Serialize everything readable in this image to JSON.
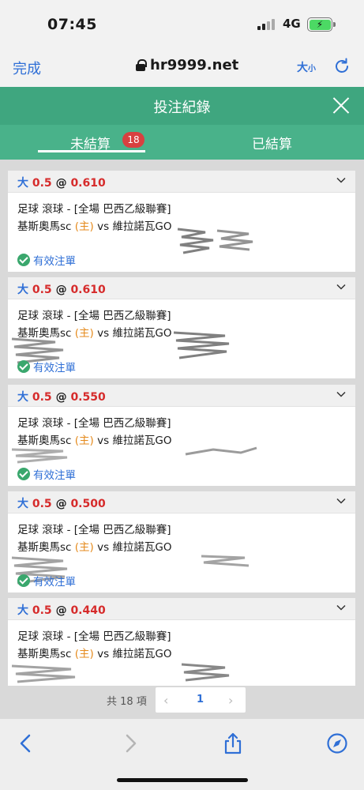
{
  "status_bar": {
    "time": "07:45",
    "network": "4G"
  },
  "browser": {
    "done_label": "完成",
    "url": "hr9999.net",
    "text_size_big": "大",
    "text_size_small": "小"
  },
  "header": {
    "title": "投注紀錄"
  },
  "tabs": {
    "unsettled": "未結算",
    "unsettled_count": "18",
    "settled": "已結算"
  },
  "bets": [
    {
      "over_label": "大",
      "line": "0.5",
      "at": "@",
      "odds": "0.610",
      "sport": "足球 滾球 - [全場 巴西乙級聯賽]",
      "team_home": "基斯奧馬sc",
      "home_tag": "(主)",
      "vs": "vs",
      "team_away": "維拉諾瓦GO",
      "status": "有效注單"
    },
    {
      "over_label": "大",
      "line": "0.5",
      "at": "@",
      "odds": "0.610",
      "sport": "足球 滾球 - [全場 巴西乙級聯賽]",
      "team_home": "基斯奧馬sc",
      "home_tag": "(主)",
      "vs": "vs",
      "team_away": "維拉諾瓦GO",
      "status": "有效注單"
    },
    {
      "over_label": "大",
      "line": "0.5",
      "at": "@",
      "odds": "0.550",
      "sport": "足球 滾球 - [全場 巴西乙級聯賽]",
      "team_home": "基斯奧馬sc",
      "home_tag": "(主)",
      "vs": "vs",
      "team_away": "維拉諾瓦GO",
      "status": "有效注單"
    },
    {
      "over_label": "大",
      "line": "0.5",
      "at": "@",
      "odds": "0.500",
      "sport": "足球 滾球 - [全場 巴西乙級聯賽]",
      "team_home": "基斯奧馬sc",
      "home_tag": "(主)",
      "vs": "vs",
      "team_away": "維拉諾瓦GO",
      "status": "有效注單"
    },
    {
      "over_label": "大",
      "line": "0.5",
      "at": "@",
      "odds": "0.440",
      "sport": "足球 滾球 - [全場 巴西乙級聯賽]",
      "team_home": "基斯奧馬sc",
      "home_tag": "(主)",
      "vs": "vs",
      "team_away": "維拉諾瓦GO",
      "status": "有效注單"
    }
  ],
  "pagination": {
    "total": "共 18 項",
    "current": "1",
    "prev": "‹",
    "next": "›"
  },
  "colors": {
    "header_green": "#3fa67f",
    "tab_green": "#49b28a",
    "link_blue": "#2f6fd6",
    "odds_red": "#d62b2b",
    "home_orange": "#e58a1c",
    "badge_red": "#d84040"
  },
  "icons": [
    "lock-icon",
    "reload-icon",
    "close-icon",
    "chevron-down-icon",
    "check-icon",
    "back-icon",
    "forward-icon",
    "share-icon",
    "compass-icon"
  ]
}
